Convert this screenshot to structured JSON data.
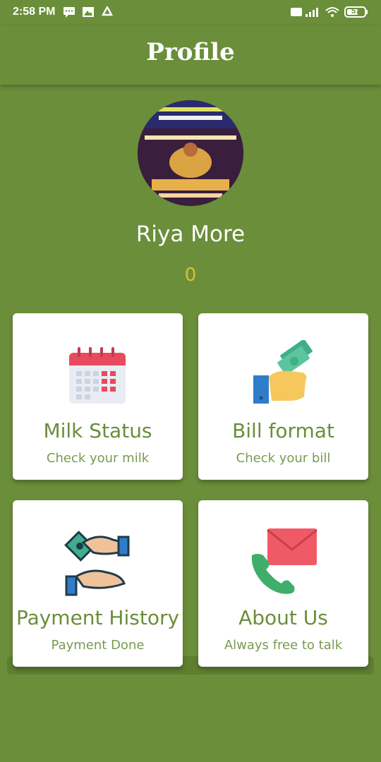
{
  "status_bar": {
    "time": "2:58 PM",
    "battery": "57"
  },
  "header": {
    "title": "Profile"
  },
  "profile": {
    "name": "Riya More",
    "count": "0"
  },
  "cards": [
    {
      "title": "Milk Status",
      "subtitle": "Check your milk",
      "icon": "calendar-icon"
    },
    {
      "title": "Bill format",
      "subtitle": "Check your bill",
      "icon": "money-hand-icon"
    },
    {
      "title": "Payment History",
      "subtitle": "Payment Done",
      "icon": "payment-exchange-icon"
    },
    {
      "title": "About Us",
      "subtitle": "Always free to talk",
      "icon": "contact-envelope-icon"
    }
  ],
  "colors": {
    "background": "#6b8e3a",
    "accent_text": "#6b8e3a",
    "counter": "#d6c232"
  }
}
